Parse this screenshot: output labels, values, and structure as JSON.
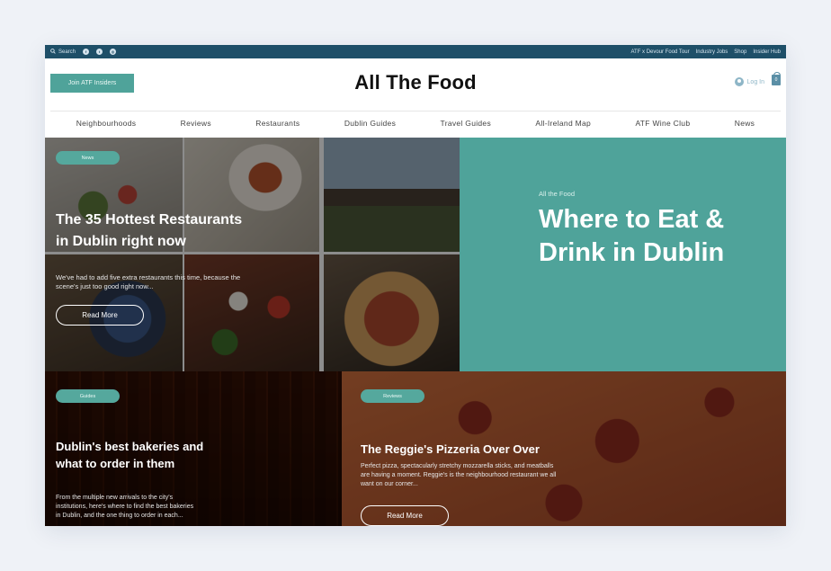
{
  "topbar": {
    "search_label": "Search",
    "social": [
      {
        "icon": "facebook-icon",
        "glyph": "f"
      },
      {
        "icon": "twitter-icon",
        "glyph": "t"
      },
      {
        "icon": "instagram-icon",
        "glyph": "◎"
      }
    ],
    "links": [
      "ATF x Devour Food Tour",
      "Industry Jobs",
      "Shop",
      "Insider Hub"
    ]
  },
  "header": {
    "join_button": "Join ATF Insiders",
    "title": "All The Food",
    "login_label": "Log In",
    "cart_count": "0"
  },
  "nav": {
    "items": [
      "Neighbourhoods",
      "Reviews",
      "Restaurants",
      "Dublin Guides",
      "Travel Guides",
      "All-Ireland Map",
      "ATF Wine Club",
      "News"
    ]
  },
  "hero": {
    "tag": "News",
    "title": "The 35 Hottest Restaurants in Dublin right now",
    "description": "We've had to add five extra restaurants this time, because the scene's just too good right now...",
    "button": "Read More"
  },
  "panel": {
    "eyebrow": "All the Food",
    "headline": "Where to Eat & Drink in Dublin"
  },
  "card_bakeries": {
    "tag": "Guides",
    "title": "Dublin's best bakeries and what to order in them",
    "description": "From the multiple new arrivals to the city's institutions, here's where to find the best bakeries in Dublin, and the one thing to order in each..."
  },
  "card_pizzeria": {
    "tag": "Reviews",
    "title": "The Reggie's Pizzeria Over Over",
    "description": "Perfect pizza, spectacularly stretchy mozzarella sticks, and meatballs are having a moment. Reggie's is the neighbourhood restaurant we all want on our corner...",
    "button": "Read More"
  },
  "colors": {
    "accent": "#4fa39a",
    "topbar": "#1e4f68",
    "page_bg": "#eff2f7"
  }
}
